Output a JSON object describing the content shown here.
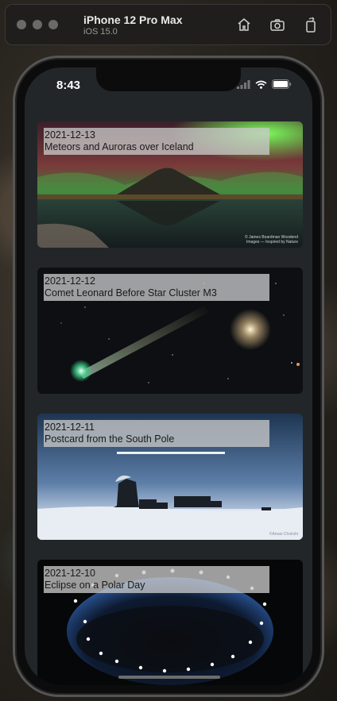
{
  "simulator": {
    "device_name": "iPhone 12 Pro Max",
    "os_version": "iOS 15.0",
    "toolbar_icons": [
      "home-icon",
      "screenshot-icon",
      "rotate-icon"
    ]
  },
  "status_bar": {
    "time": "8:43",
    "icons": [
      "signal-icon",
      "wifi-icon",
      "battery-icon"
    ]
  },
  "feed": {
    "items": [
      {
        "date": "2021-12-13",
        "title": "Meteors and Auroras over Iceland",
        "credit": "© James Boardman Woodend\nImages — Inspired by Nature"
      },
      {
        "date": "2021-12-12",
        "title": "Comet Leonard Before Star Cluster M3"
      },
      {
        "date": "2021-12-11",
        "title": "Postcard from the South Pole",
        "credit": "©Aman Chokshi"
      },
      {
        "date": "2021-12-10",
        "title": "Eclipse on a Polar Day"
      }
    ]
  }
}
